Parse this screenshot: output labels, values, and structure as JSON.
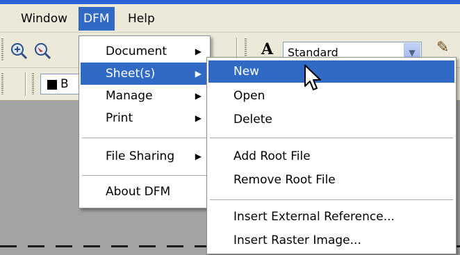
{
  "menubar": {
    "items": [
      {
        "label": "Window"
      },
      {
        "label": "DFM"
      },
      {
        "label": "Help"
      }
    ]
  },
  "toolbar": {
    "text_style_value": "Standard",
    "color_value": "B"
  },
  "dfm_menu": {
    "items": [
      {
        "label": "Document",
        "has_submenu": true
      },
      {
        "label": "Sheet(s)",
        "has_submenu": true,
        "highlighted": true
      },
      {
        "label": "Manage",
        "has_submenu": true
      },
      {
        "label": "Print",
        "has_submenu": true
      },
      {
        "label": "File Sharing",
        "has_submenu": true
      },
      {
        "label": "About DFM",
        "has_submenu": false
      }
    ]
  },
  "sheets_menu": {
    "items": [
      {
        "label": "New",
        "highlighted": true
      },
      {
        "label": "Open"
      },
      {
        "label": "Delete"
      },
      {
        "label": "Add Root File"
      },
      {
        "label": "Remove Root File"
      },
      {
        "label": "Insert External Reference..."
      },
      {
        "label": "Insert Raster Image..."
      }
    ]
  },
  "icons": [
    "zoom-in-icon",
    "zoom-realtime-icon",
    "text-style-icon",
    "pen-icon",
    "submenu-arrow-icon",
    "mouse-cursor-icon"
  ],
  "colors": {
    "highlight": "#316ac5",
    "menubar": "#ece9d8",
    "canvas": "#a3a3a3",
    "title_strip": "#2a60d8"
  }
}
